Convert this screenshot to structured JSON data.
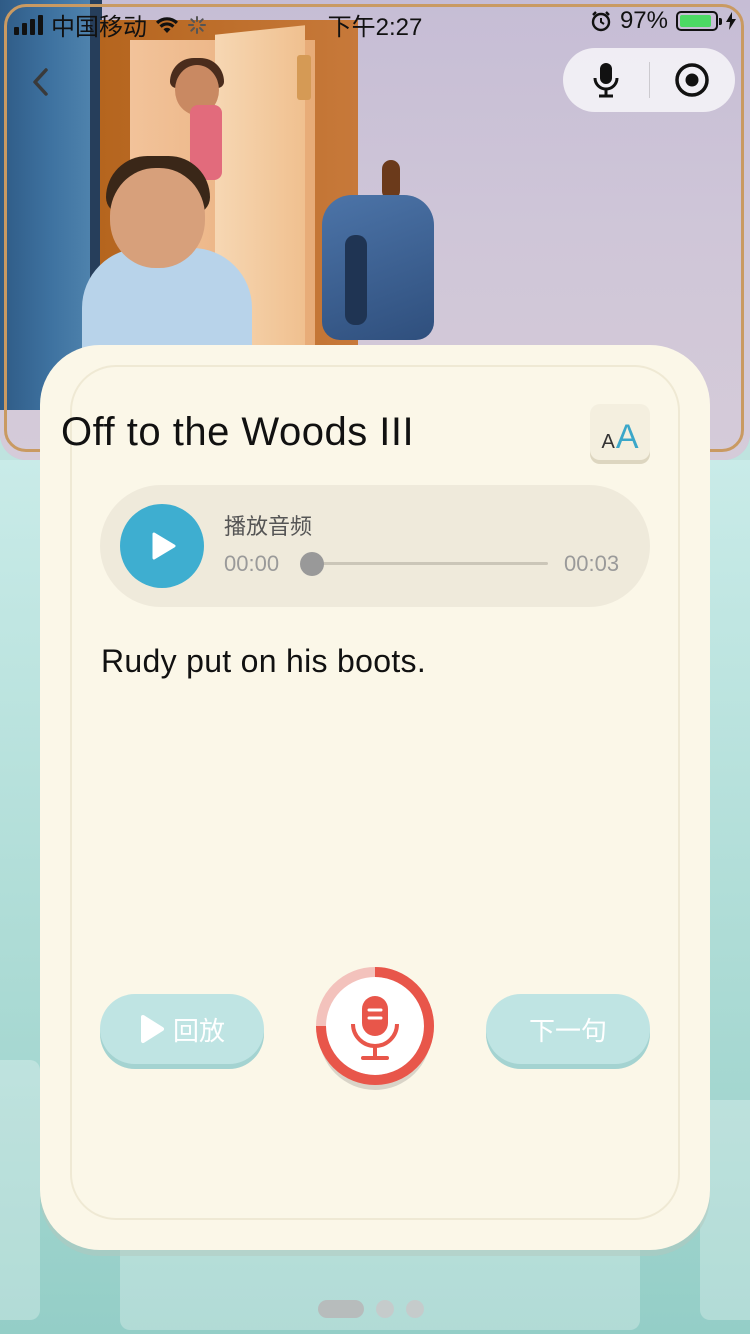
{
  "status_bar": {
    "carrier": "中国移动",
    "time": "下午2:27",
    "battery": "97%"
  },
  "lesson": {
    "title": "Off to the Woods III",
    "font_size_icon_small": "A",
    "font_size_icon_large": "A",
    "sentence": "Rudy put on his boots."
  },
  "audio_player": {
    "label": "播放音频",
    "current_time": "00:00",
    "duration": "00:03",
    "progress": 0
  },
  "controls": {
    "replay_label": "回放",
    "next_label": "下一句"
  },
  "pager": {
    "count": 3,
    "active": 0
  },
  "colors": {
    "accent_blue": "#3eaed0",
    "record_red": "#e8564a",
    "card_bg": "#fbf7e8",
    "teal_bg": "#aedcd6"
  },
  "icons": [
    "back-icon",
    "microphone-icon",
    "record-target-icon",
    "play-icon",
    "record-mic-icon"
  ]
}
